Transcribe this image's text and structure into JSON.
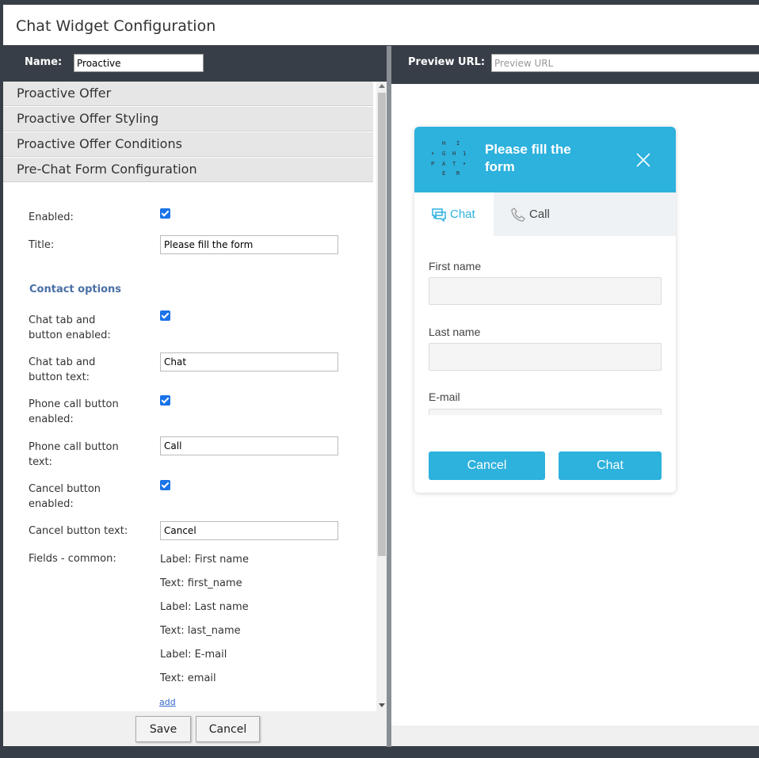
{
  "window": {
    "title": "Chat Widget Configuration"
  },
  "left": {
    "name_label": "Name:",
    "name_value": "Proactive",
    "sections": [
      "Proactive Offer",
      "Proactive Offer Styling",
      "Proactive Offer Conditions",
      "Pre-Chat Form Configuration"
    ],
    "form": {
      "enabled_label": "Enabled:",
      "title_label": "Title:",
      "title_value": "Please fill the form",
      "contact_options_heading": "Contact options",
      "chat_tab_enabled_label": "Chat tab and button enabled:",
      "chat_tab_text_label": "Chat tab and button text:",
      "chat_tab_text_value": "Chat",
      "phone_enabled_label": "Phone call button enabled:",
      "phone_text_label": "Phone call button text:",
      "phone_text_value": "Call",
      "cancel_enabled_label": "Cancel button enabled:",
      "cancel_text_label": "Cancel button text:",
      "cancel_text_value": "Cancel",
      "fields_label": "Fields - common:",
      "fields": [
        "Label: First name",
        "Text: first_name",
        "Label: Last name",
        "Text: last_name",
        "Label: E-mail",
        "Text: email"
      ],
      "add_link": "add"
    },
    "footer": {
      "save": "Save",
      "cancel": "Cancel"
    }
  },
  "right": {
    "url_label": "Preview URL:",
    "url_placeholder": "Preview URL",
    "widget": {
      "logo_text": "HI GH PAT ER",
      "title": "Please fill the form",
      "tab_chat": "Chat",
      "tab_call": "Call",
      "first_name": "First name",
      "last_name": "Last name",
      "email": "E-mail",
      "cancel_button": "Cancel",
      "chat_button": "Chat"
    }
  },
  "colors": {
    "accent": "#2db1dd",
    "dark_bar": "#383e47",
    "section_heading": "#4a6fa5"
  }
}
